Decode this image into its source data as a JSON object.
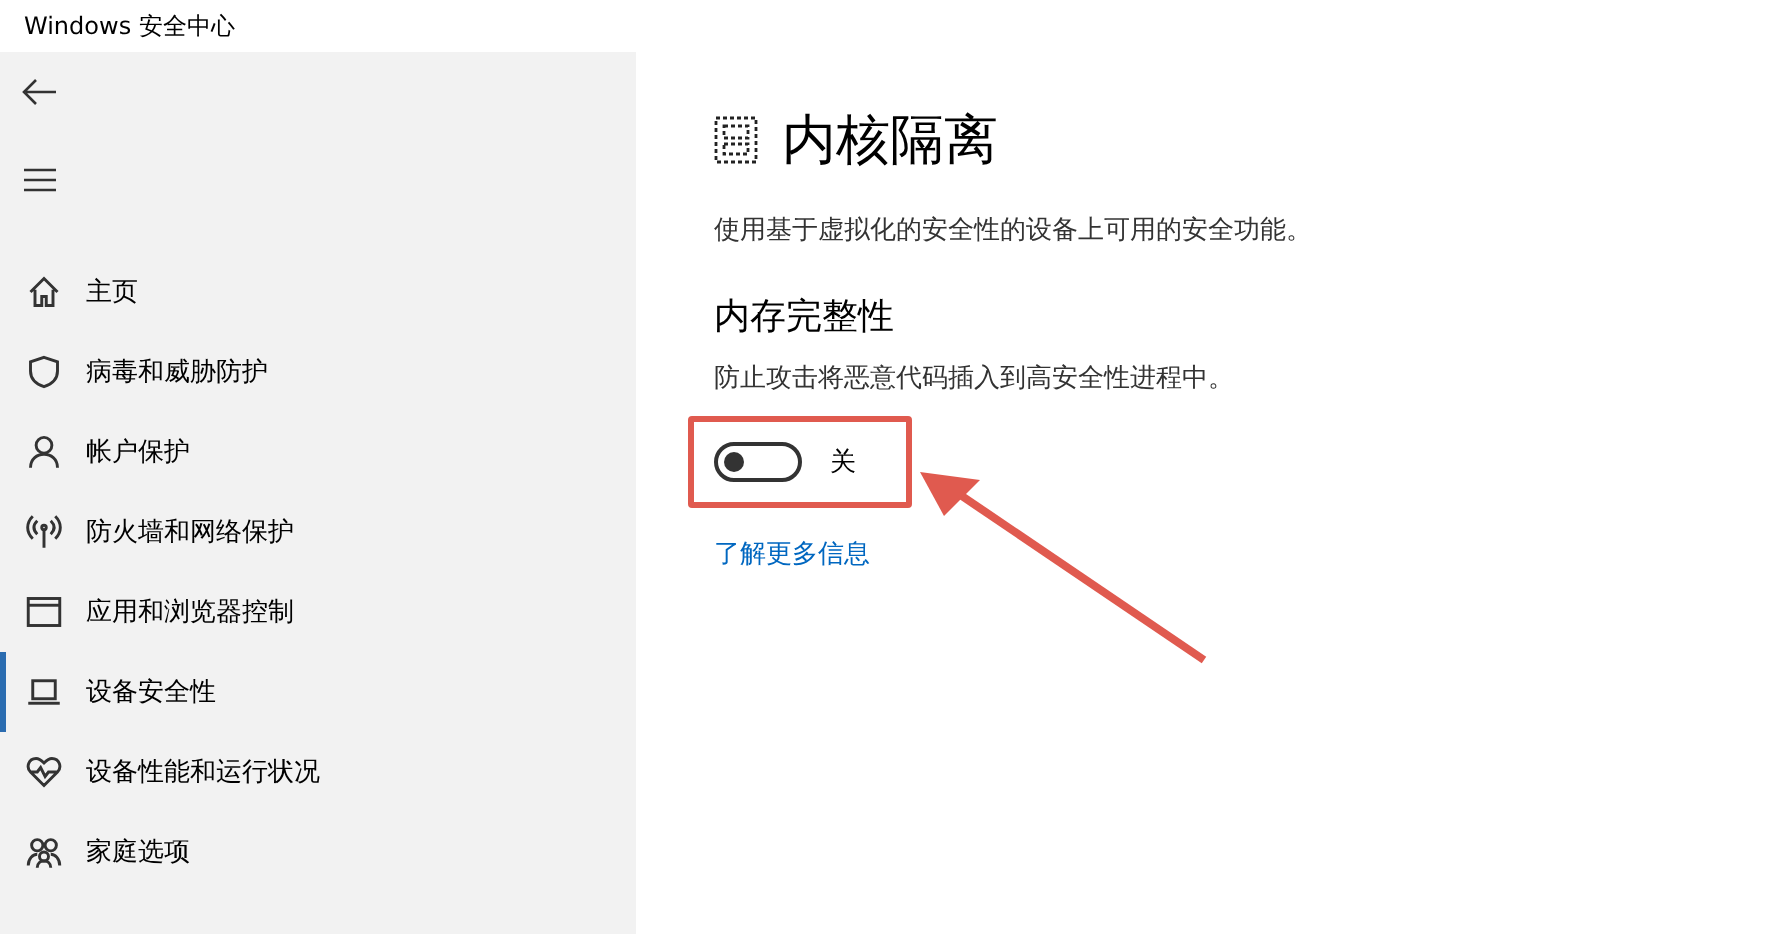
{
  "window": {
    "title": "Windows 安全中心"
  },
  "sidebar": {
    "items": [
      {
        "label": "主页",
        "selected": false
      },
      {
        "label": "病毒和威胁防护",
        "selected": false
      },
      {
        "label": "帐户保护",
        "selected": false
      },
      {
        "label": "防火墙和网络保护",
        "selected": false
      },
      {
        "label": "应用和浏览器控制",
        "selected": false
      },
      {
        "label": "设备安全性",
        "selected": true
      },
      {
        "label": "设备性能和运行状况",
        "selected": false
      },
      {
        "label": "家庭选项",
        "selected": false
      }
    ]
  },
  "page": {
    "title": "内核隔离",
    "description": "使用基于虚拟化的安全性的设备上可用的安全功能。",
    "section": {
      "title": "内存完整性",
      "description": "防止攻击将恶意代码插入到高安全性进程中。",
      "toggle": {
        "on": false,
        "label": "关"
      },
      "link": "了解更多信息"
    }
  }
}
